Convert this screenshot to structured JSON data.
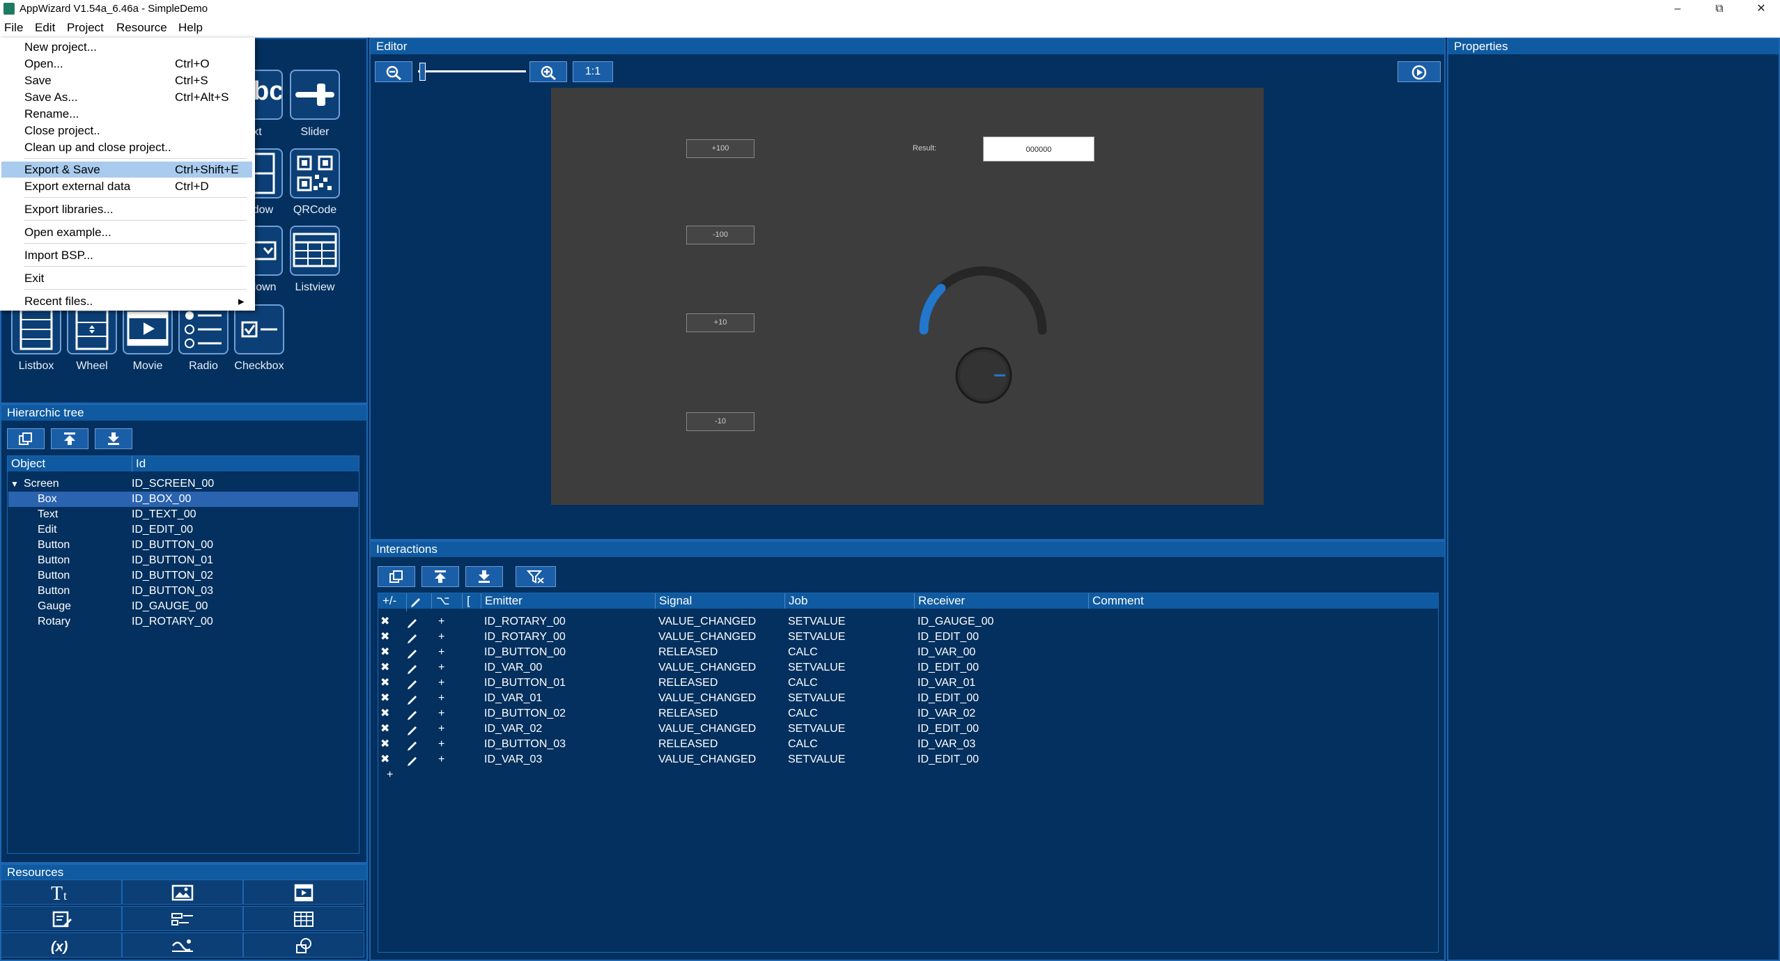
{
  "window": {
    "title": "AppWizard V1.54a_6.46a - SimpleDemo",
    "minimize": "–",
    "maximize": "⧉",
    "close": "✕"
  },
  "menubar": [
    "File",
    "Edit",
    "Project",
    "Resource",
    "Help"
  ],
  "file_menu": [
    {
      "label": "New project...",
      "shortcut": ""
    },
    {
      "label": "Open...",
      "shortcut": "Ctrl+O"
    },
    {
      "label": "Save",
      "shortcut": "Ctrl+S"
    },
    {
      "label": "Save As...",
      "shortcut": "Ctrl+Alt+S"
    },
    {
      "label": "Rename...",
      "shortcut": ""
    },
    {
      "label": "Close project..",
      "shortcut": ""
    },
    {
      "label": "Clean up and close project..",
      "shortcut": ""
    },
    {
      "label": "Export & Save",
      "shortcut": "Ctrl+Shift+E"
    },
    {
      "label": "Export external data",
      "shortcut": "Ctrl+D"
    },
    {
      "label": "Export libraries...",
      "shortcut": ""
    },
    {
      "label": "Open example...",
      "shortcut": ""
    },
    {
      "label": "Import BSP...",
      "shortcut": ""
    },
    {
      "label": "Exit",
      "shortcut": ""
    },
    {
      "label": "Recent files..",
      "shortcut": "▸"
    }
  ],
  "widgets": {
    "partial_labels": [
      "ext",
      "ndow",
      "pdown"
    ],
    "partial_glyph": "bc",
    "labels": [
      "Slider",
      "QRCode",
      "Listview",
      "Listbox",
      "Wheel",
      "Movie",
      "Radio",
      "Checkbox"
    ]
  },
  "tree": {
    "header": "Hierarchic tree",
    "columns": [
      "Object",
      "Id"
    ],
    "expand_glyph": "▼",
    "rows": [
      {
        "object": "Screen",
        "id": "ID_SCREEN_00"
      },
      {
        "object": "Box",
        "id": "ID_BOX_00"
      },
      {
        "object": "Text",
        "id": "ID_TEXT_00"
      },
      {
        "object": "Edit",
        "id": "ID_EDIT_00"
      },
      {
        "object": "Button",
        "id": "ID_BUTTON_00"
      },
      {
        "object": "Button",
        "id": "ID_BUTTON_01"
      },
      {
        "object": "Button",
        "id": "ID_BUTTON_02"
      },
      {
        "object": "Button",
        "id": "ID_BUTTON_03"
      },
      {
        "object": "Gauge",
        "id": "ID_GAUGE_00"
      },
      {
        "object": "Rotary",
        "id": "ID_ROTARY_00"
      }
    ]
  },
  "resources": {
    "header": "Resources"
  },
  "editor": {
    "header": "Editor",
    "zoom_label": "1:1",
    "buttons": [
      "+100",
      "-100",
      "+10",
      "-10"
    ],
    "result_label": "Result:",
    "result_value": "000000"
  },
  "interactions": {
    "header": "Interactions",
    "columns": [
      "+/-",
      "",
      "⌥",
      "[",
      "Emitter",
      "Signal",
      "Job",
      "Receiver",
      "Comment"
    ],
    "rows": [
      {
        "emitter": "ID_ROTARY_00",
        "signal": "VALUE_CHANGED",
        "job": "SETVALUE",
        "receiver": "ID_GAUGE_00"
      },
      {
        "emitter": "ID_ROTARY_00",
        "signal": "VALUE_CHANGED",
        "job": "SETVALUE",
        "receiver": "ID_EDIT_00"
      },
      {
        "emitter": "ID_BUTTON_00",
        "signal": "RELEASED",
        "job": "CALC",
        "receiver": "ID_VAR_00"
      },
      {
        "emitter": "ID_VAR_00",
        "signal": "VALUE_CHANGED",
        "job": "SETVALUE",
        "receiver": "ID_EDIT_00"
      },
      {
        "emitter": "ID_BUTTON_01",
        "signal": "RELEASED",
        "job": "CALC",
        "receiver": "ID_VAR_01"
      },
      {
        "emitter": "ID_VAR_01",
        "signal": "VALUE_CHANGED",
        "job": "SETVALUE",
        "receiver": "ID_EDIT_00"
      },
      {
        "emitter": "ID_BUTTON_02",
        "signal": "RELEASED",
        "job": "CALC",
        "receiver": "ID_VAR_02"
      },
      {
        "emitter": "ID_VAR_02",
        "signal": "VALUE_CHANGED",
        "job": "SETVALUE",
        "receiver": "ID_EDIT_00"
      },
      {
        "emitter": "ID_BUTTON_03",
        "signal": "RELEASED",
        "job": "CALC",
        "receiver": "ID_VAR_03"
      },
      {
        "emitter": "ID_VAR_03",
        "signal": "VALUE_CHANGED",
        "job": "SETVALUE",
        "receiver": "ID_EDIT_00"
      }
    ],
    "add_glyph": "+",
    "row_delete": "✖",
    "row_plus": "+"
  },
  "properties": {
    "header": "Properties"
  },
  "colors": {
    "background": "#03305e",
    "panel_header": "#0f5aa0",
    "selection": "#2a63b0",
    "menu_highlight": "#a9cbee",
    "gauge_arc": "#2277cc"
  }
}
